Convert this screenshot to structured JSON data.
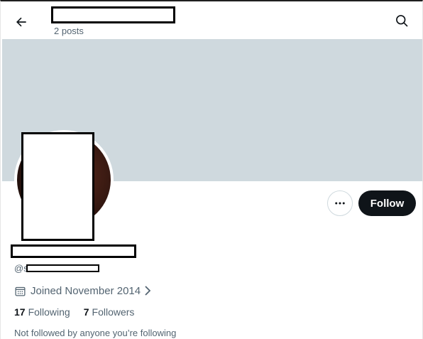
{
  "header": {
    "post_count": "2 posts"
  },
  "actions": {
    "follow_label": "Follow"
  },
  "profile": {
    "handle_prefix": "@s",
    "joined": "Joined November 2014",
    "following_count": "17",
    "following_label": "Following",
    "followers_count": "7",
    "followers_label": "Followers",
    "followed_by": "Not followed by anyone you’re following"
  },
  "colors": {
    "banner": "#cfd9de",
    "follow_button_bg": "#0f1419",
    "secondary_text": "#536471"
  },
  "icons": {
    "back": "arrow-left-icon",
    "search": "search-icon",
    "more": "more-dots-icon",
    "calendar": "calendar-icon",
    "chevron": "chevron-right-icon"
  }
}
